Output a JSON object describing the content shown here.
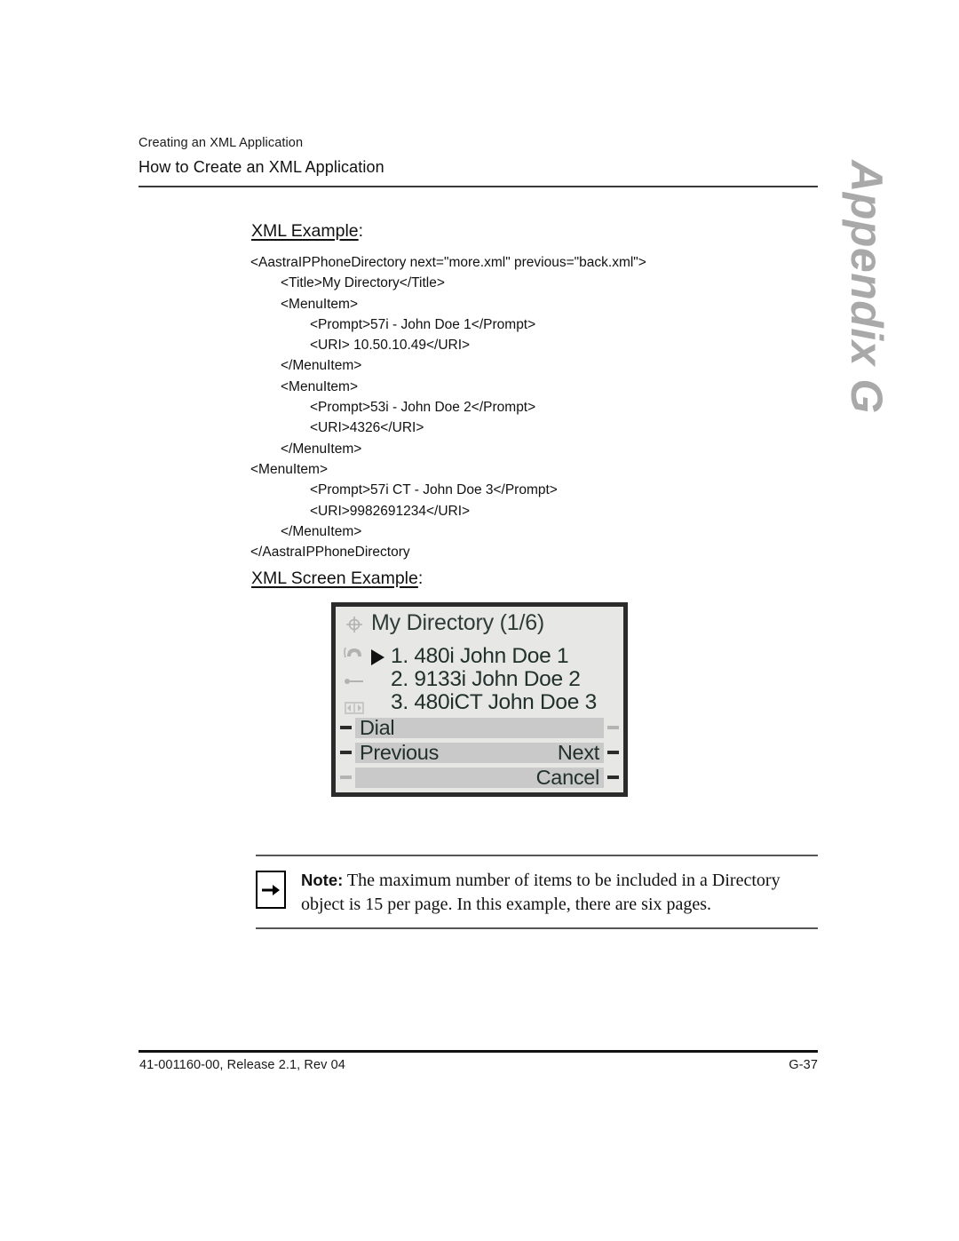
{
  "header": {
    "eyebrow": "Creating an XML Application",
    "title": "How to Create an XML Application"
  },
  "appendix_tab": {
    "label": "Appendix G",
    "color": "#a9a9a9"
  },
  "sections": {
    "xml_example": {
      "heading_underlined": "XML Example",
      "heading_suffix": ":"
    },
    "xml_screen_example": {
      "heading_underlined": "XML Screen Example",
      "heading_suffix": ":"
    }
  },
  "xml_listing": {
    "lines": [
      {
        "indent": 0,
        "text": "<AastraIPPhoneDirectory next=\"more.xml\" previous=\"back.xml\">"
      },
      {
        "indent": 1,
        "text": "<Title>My Directory</Title>"
      },
      {
        "indent": 1,
        "text": "<MenuItem>"
      },
      {
        "indent": 2,
        "text": "<Prompt>57i - John Doe 1</Prompt>"
      },
      {
        "indent": 2,
        "text": "<URI> 10.50.10.49</URI>"
      },
      {
        "indent": 1,
        "text": "</MenuItem>"
      },
      {
        "indent": 1,
        "text": "<MenuItem>"
      },
      {
        "indent": 2,
        "text": "<Prompt>53i - John Doe 2</Prompt>"
      },
      {
        "indent": 2,
        "text": "<URI>4326</URI>"
      },
      {
        "indent": 1,
        "text": "</MenuItem>"
      },
      {
        "indent": 0,
        "text": "<MenuItem>"
      },
      {
        "indent": 2,
        "text": "<Prompt>57i CT - John Doe 3</Prompt>"
      },
      {
        "indent": 2,
        "text": "<URI>9982691234</URI>"
      },
      {
        "indent": 1,
        "text": "</MenuItem>"
      },
      {
        "indent": 0,
        "text": "</AastraIPPhoneDirectory"
      }
    ]
  },
  "phone_screen": {
    "title": "My Directory (1/6)",
    "background_color": "#e7e7e5",
    "bezel_color": "#2b2b2b",
    "softkey_fill": "#c9c9c9",
    "feature_icons": [
      "network-icon",
      "handset-icon",
      "line-key-icon",
      "navigation-icon"
    ],
    "list_items": [
      {
        "text": "1. 480i John Doe 1",
        "selected": true
      },
      {
        "text": "2. 9133i John Doe 2",
        "selected": false
      },
      {
        "text": "3. 480iCT John Doe 3",
        "selected": false
      }
    ],
    "softkeys": [
      {
        "left": "Dial",
        "right": "",
        "left_dash": true,
        "right_dash": true,
        "right_dash_faint": true
      },
      {
        "left": "Previous",
        "right": "Next",
        "left_dash": true,
        "right_dash": true,
        "right_dash_faint": false
      },
      {
        "left": "",
        "right": "Cancel",
        "left_dash": true,
        "left_dash_faint": true,
        "right_dash": true,
        "right_dash_faint": false
      }
    ]
  },
  "note": {
    "icon": "right-arrow-icon",
    "label": "Note:",
    "text": " The maximum number of items to be included in a Directory object is 15 per page. In this example, there are six pages."
  },
  "footer": {
    "left": "41-001160-00, Release 2.1, Rev 04",
    "right": "G-37"
  }
}
